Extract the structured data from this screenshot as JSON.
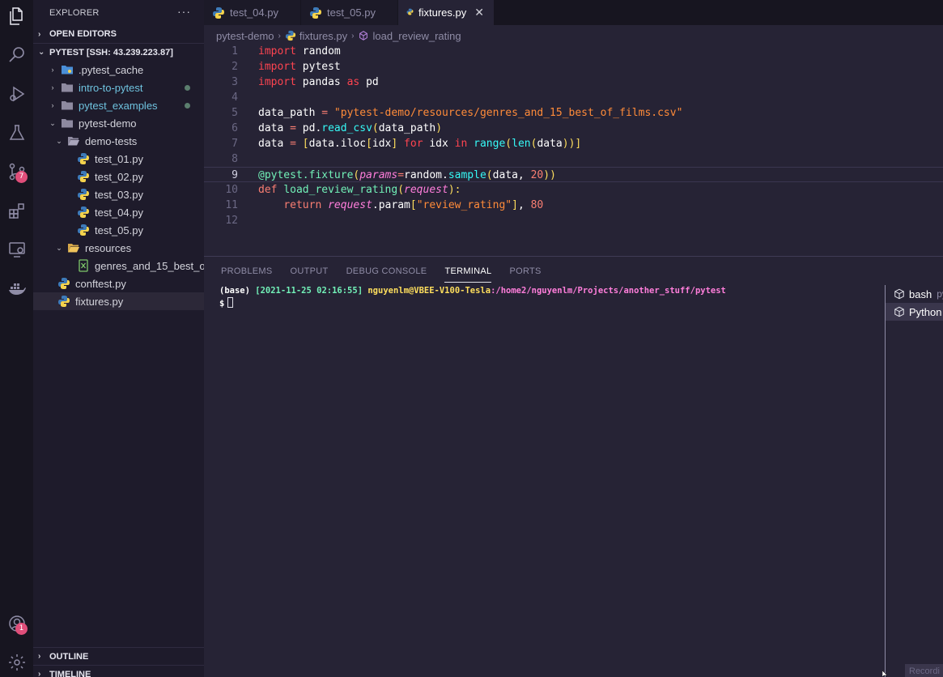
{
  "activity_bar": {
    "scm_badge": "7",
    "accounts_badge": "1"
  },
  "sidebar": {
    "title": "EXPLORER",
    "more": "···",
    "open_editors": "OPEN EDITORS",
    "workspace": "PYTEST [SSH: 43.239.223.87]",
    "tree": [
      {
        "label": ".pytest_cache",
        "indent": 1,
        "type": "folder-blue",
        "chev": "›",
        "mod": false,
        "dot": false
      },
      {
        "label": "intro-to-pytest",
        "indent": 1,
        "type": "folder",
        "chev": "›",
        "mod": true,
        "dot": true
      },
      {
        "label": "pytest_examples",
        "indent": 1,
        "type": "folder",
        "chev": "›",
        "mod": true,
        "dot": true
      },
      {
        "label": "pytest-demo",
        "indent": 1,
        "type": "folder",
        "chev": "⌄",
        "mod": false,
        "dot": false
      },
      {
        "label": "demo-tests",
        "indent": 2,
        "type": "folder-open",
        "chev": "⌄",
        "mod": false,
        "dot": false
      },
      {
        "label": "test_01.py",
        "indent": 3,
        "type": "python",
        "chev": "",
        "mod": false,
        "dot": false
      },
      {
        "label": "test_02.py",
        "indent": 3,
        "type": "python",
        "chev": "",
        "mod": false,
        "dot": false
      },
      {
        "label": "test_03.py",
        "indent": 3,
        "type": "python",
        "chev": "",
        "mod": false,
        "dot": false
      },
      {
        "label": "test_04.py",
        "indent": 3,
        "type": "python",
        "chev": "",
        "mod": false,
        "dot": false
      },
      {
        "label": "test_05.py",
        "indent": 3,
        "type": "python",
        "chev": "",
        "mod": false,
        "dot": false
      },
      {
        "label": "resources",
        "indent": 2,
        "type": "folder-yellow",
        "chev": "⌄",
        "mod": false,
        "dot": false
      },
      {
        "label": "genres_and_15_best_o...",
        "indent": 3,
        "type": "csv",
        "chev": "",
        "mod": false,
        "dot": false
      },
      {
        "label": "conftest.py",
        "indent": 2,
        "type": "python",
        "chev": "",
        "mod": false,
        "dot": false
      },
      {
        "label": "fixtures.py",
        "indent": 2,
        "type": "python",
        "chev": "",
        "mod": false,
        "dot": false,
        "active": true
      }
    ],
    "outline": "OUTLINE",
    "timeline": "TIMELINE"
  },
  "tabs": [
    {
      "label": "test_04.py",
      "active": false
    },
    {
      "label": "test_05.py",
      "active": false
    },
    {
      "label": "fixtures.py",
      "active": true
    }
  ],
  "tab_close": "✕",
  "breadcrumb": {
    "folder": "pytest-demo",
    "file": "fixtures.py",
    "symbol": "load_review_rating"
  },
  "editor": {
    "current_line": 9,
    "lines": [
      {
        "n": "1",
        "tokens": [
          [
            "kw2",
            "import"
          ],
          [
            "",
            "random"
          ]
        ]
      },
      {
        "n": "2",
        "tokens": [
          [
            "kw2",
            "import"
          ],
          [
            "",
            "pytest"
          ]
        ]
      },
      {
        "n": "3",
        "tokens": [
          [
            "kw2",
            "import"
          ],
          [
            "",
            "pandas "
          ],
          [
            "kw2",
            "as"
          ],
          [
            "",
            " pd"
          ]
        ]
      },
      {
        "n": "4",
        "tokens": []
      },
      {
        "n": "5",
        "tokens": [
          [
            "",
            "data_path "
          ],
          [
            "kwp",
            "="
          ],
          [
            "",
            ""
          ],
          [
            "str",
            " \"pytest-demo/resources/genres_and_15_best_of_films.csv\""
          ]
        ]
      },
      {
        "n": "6",
        "tokens": [
          [
            "",
            "data "
          ],
          [
            "kwp",
            "="
          ],
          [
            "",
            " pd."
          ],
          [
            "fn",
            "read_csv"
          ],
          [
            "brk",
            "("
          ],
          [
            "",
            "data_path"
          ],
          [
            "brk",
            ")"
          ]
        ]
      },
      {
        "n": "7",
        "tokens": [
          [
            "",
            "data "
          ],
          [
            "kwp",
            "="
          ],
          [
            "",
            " "
          ],
          [
            "brk",
            "["
          ],
          [
            "",
            "data.iloc"
          ],
          [
            "brk",
            "["
          ],
          [
            "",
            "idx"
          ],
          [
            "brk",
            "]"
          ],
          [
            "",
            " "
          ],
          [
            "kw2",
            "for"
          ],
          [
            "",
            " idx "
          ],
          [
            "kw2",
            "in"
          ],
          [
            "",
            " "
          ],
          [
            "fn",
            "range"
          ],
          [
            "brk",
            "("
          ],
          [
            "fn",
            "len"
          ],
          [
            "brk",
            "("
          ],
          [
            "",
            "data"
          ],
          [
            "brk",
            "))]"
          ]
        ]
      },
      {
        "n": "8",
        "tokens": []
      },
      {
        "n": "9",
        "tokens": [
          [
            "dec",
            "@pytest.fixture"
          ],
          [
            "brk",
            "("
          ],
          [
            "param",
            "params"
          ],
          [
            "kwp",
            "="
          ],
          [
            "",
            "random."
          ],
          [
            "fn",
            "sample"
          ],
          [
            "brk",
            "("
          ],
          [
            "",
            "data, "
          ],
          [
            "num",
            "20"
          ],
          [
            "brk",
            "))"
          ]
        ]
      },
      {
        "n": "10",
        "tokens": [
          [
            "kwp",
            "def"
          ],
          [
            "",
            " "
          ],
          [
            "dec",
            "load_review_rating"
          ],
          [
            "brk",
            "("
          ],
          [
            "param",
            "request"
          ],
          [
            "brk",
            "):"
          ]
        ]
      },
      {
        "n": "11",
        "tokens": [
          [
            "",
            "    "
          ],
          [
            "kwp",
            "return"
          ],
          [
            "",
            " "
          ],
          [
            "param",
            "request"
          ],
          [
            "",
            ".param"
          ],
          [
            "brk",
            "["
          ],
          [
            "str",
            "\"review_rating\""
          ],
          [
            "brk",
            "]"
          ],
          [
            "",
            ", "
          ],
          [
            "num",
            "80"
          ]
        ]
      },
      {
        "n": "12",
        "tokens": []
      }
    ]
  },
  "panel": {
    "tabs": [
      "PROBLEMS",
      "OUTPUT",
      "DEBUG CONSOLE",
      "TERMINAL",
      "PORTS"
    ],
    "active_tab": "TERMINAL",
    "terminal": {
      "base": "(base)",
      "datetime": "[2021-11-25 02:16:55]",
      "user_host": "nguyenlm@VBEE-V100-Tesla",
      "path": ":/home2/nguyenlm/Projects/another_stuff/pytest",
      "prompt": "$"
    },
    "terminal_list": [
      {
        "label": "bash",
        "hint": "py",
        "selected": false
      },
      {
        "label": "Python",
        "hint": "",
        "selected": true
      }
    ],
    "recording": "Recordi"
  }
}
